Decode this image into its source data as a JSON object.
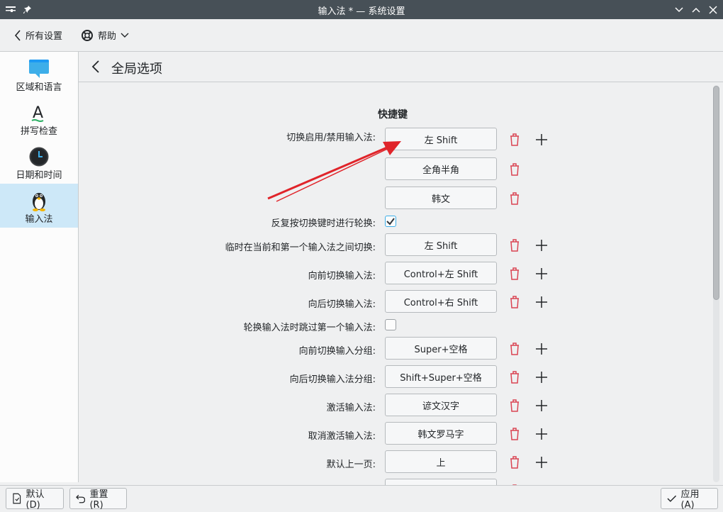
{
  "window": {
    "title": "输入法 * — 系统设置"
  },
  "toolbar": {
    "all_settings": "所有设置",
    "help": "帮助"
  },
  "sidebar": {
    "items": [
      {
        "label": "区域和语言",
        "icon": "region-language-icon"
      },
      {
        "label": "拼写检查",
        "icon": "spellcheck-icon"
      },
      {
        "label": "日期和时间",
        "icon": "clock-icon"
      },
      {
        "label": "输入法",
        "icon": "penguin-icon",
        "selected": true
      }
    ]
  },
  "page": {
    "title": "全局选项"
  },
  "shortcuts": {
    "section_title": "快捷键",
    "toggle_label": "切换启用/禁用输入法:",
    "toggle_keys": [
      "左 Shift",
      "全角半角",
      "韩文"
    ],
    "cycle_label": "反复按切换键时进行轮换:",
    "cycle_checked": true,
    "temp_label": "临时在当前和第一个输入法之间切换:",
    "temp_key": "左 Shift",
    "forward_label": "向前切换输入法:",
    "forward_key": "Control+左 Shift",
    "backward_label": "向后切换输入法:",
    "backward_key": "Control+右 Shift",
    "skip_label": "轮换输入法时跳过第一个输入法:",
    "skip_checked": false,
    "fwd_group_label": "向前切换输入分组:",
    "fwd_group_key": "Super+空格",
    "bwd_group_label": "向后切换输入法分组:",
    "bwd_group_key": "Shift+Super+空格",
    "activate_label": "激活输入法:",
    "activate_key": "谚文汉字",
    "deactivate_label": "取消激活输入法:",
    "deactivate_key": "韩文罗马字",
    "prev_page_label": "默认上一页:",
    "prev_page_key": "上"
  },
  "buttons": {
    "defaults": "默认(D)",
    "reset": "重置(R)",
    "apply": "应用(A)"
  },
  "colors": {
    "titlebar": "#475057",
    "accent": "#3daee9",
    "delete": "#da4453",
    "annotation_arrow": "#e0242a"
  }
}
